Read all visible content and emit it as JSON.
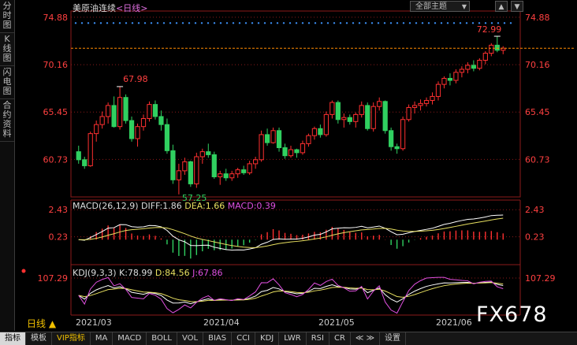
{
  "sidebar": [
    {
      "label": "分时图",
      "active": false
    },
    {
      "label": "K线图",
      "active": true
    },
    {
      "label": "闪电图",
      "active": false
    },
    {
      "label": "合约资料",
      "active": false
    }
  ],
  "header": {
    "symbol": "美原油连续",
    "period": "<日线>",
    "theme_label": "全部主题",
    "up_icon": "triangle-up-icon",
    "down_icon": "triangle-down-icon"
  },
  "chart_data": {
    "type": "candlestick",
    "price_axis": {
      "ticks": [
        "74.88",
        "70.16",
        "65.45",
        "60.73"
      ],
      "range": [
        57.0,
        75.5
      ]
    },
    "annotations": {
      "high": "67.98",
      "low": "57.25",
      "last_high": "72.99"
    },
    "dates": [
      "2021/03",
      "2021/04",
      "2021/05",
      "2021/06"
    ],
    "ohlc": [
      [
        61.5,
        62.1,
        60.3,
        60.7
      ],
      [
        60.7,
        61.0,
        59.8,
        60.1
      ],
      [
        60.1,
        63.5,
        60.0,
        63.3
      ],
      [
        63.3,
        64.6,
        62.5,
        64.2
      ],
      [
        64.2,
        65.5,
        63.8,
        65.0
      ],
      [
        65.0,
        66.4,
        64.3,
        66.1
      ],
      [
        66.1,
        67.0,
        63.9,
        64.0
      ],
      [
        64.0,
        67.98,
        63.7,
        66.9
      ],
      [
        66.9,
        67.2,
        64.3,
        64.6
      ],
      [
        64.6,
        65.0,
        62.5,
        62.8
      ],
      [
        62.8,
        64.3,
        62.0,
        64.0
      ],
      [
        64.0,
        65.2,
        63.6,
        64.8
      ],
      [
        64.8,
        66.5,
        64.5,
        66.2
      ],
      [
        66.2,
        66.6,
        64.7,
        65.0
      ],
      [
        65.0,
        65.6,
        63.6,
        64.2
      ],
      [
        64.2,
        64.8,
        61.3,
        61.6
      ],
      [
        61.6,
        62.2,
        58.3,
        58.7
      ],
      [
        58.7,
        60.3,
        57.25,
        59.6
      ],
      [
        59.6,
        60.9,
        59.2,
        60.5
      ],
      [
        60.5,
        60.6,
        58.0,
        58.3
      ],
      [
        58.3,
        61.4,
        57.9,
        61.0
      ],
      [
        61.0,
        61.8,
        60.3,
        61.5
      ],
      [
        61.5,
        62.3,
        60.9,
        61.2
      ],
      [
        61.2,
        61.5,
        58.8,
        59.0
      ],
      [
        59.0,
        59.6,
        58.2,
        59.3
      ],
      [
        59.3,
        59.8,
        58.6,
        58.9
      ],
      [
        58.9,
        59.6,
        58.6,
        59.3
      ],
      [
        59.3,
        59.9,
        58.9,
        59.7
      ],
      [
        59.7,
        60.1,
        59.2,
        59.4
      ],
      [
        59.4,
        60.6,
        59.2,
        60.3
      ],
      [
        60.3,
        61.0,
        59.8,
        60.7
      ],
      [
        60.7,
        63.6,
        60.5,
        63.2
      ],
      [
        63.2,
        63.8,
        62.1,
        62.4
      ],
      [
        62.4,
        63.9,
        62.3,
        63.6
      ],
      [
        63.6,
        63.9,
        61.5,
        61.9
      ],
      [
        61.9,
        62.3,
        60.8,
        61.1
      ],
      [
        61.1,
        62.1,
        60.9,
        61.7
      ],
      [
        61.7,
        61.8,
        60.9,
        61.4
      ],
      [
        61.4,
        62.6,
        61.2,
        62.3
      ],
      [
        62.3,
        63.3,
        62.0,
        63.1
      ],
      [
        63.1,
        64.0,
        62.7,
        63.8
      ],
      [
        63.8,
        64.2,
        62.9,
        63.2
      ],
      [
        63.2,
        65.5,
        63.0,
        65.2
      ],
      [
        65.2,
        66.6,
        64.8,
        66.4
      ],
      [
        66.4,
        66.6,
        64.3,
        64.7
      ],
      [
        64.7,
        65.3,
        63.9,
        64.9
      ],
      [
        64.9,
        65.2,
        64.2,
        64.5
      ],
      [
        64.5,
        65.4,
        63.9,
        65.2
      ],
      [
        65.2,
        66.5,
        64.9,
        66.1
      ],
      [
        66.1,
        66.4,
        63.6,
        63.8
      ],
      [
        63.8,
        66.4,
        63.5,
        66.0
      ],
      [
        66.0,
        66.9,
        65.6,
        66.5
      ],
      [
        66.5,
        66.6,
        63.3,
        63.6
      ],
      [
        63.6,
        63.9,
        61.6,
        62.0
      ],
      [
        62.0,
        62.3,
        61.3,
        61.8
      ],
      [
        61.8,
        65.0,
        61.6,
        64.7
      ],
      [
        64.7,
        66.2,
        64.5,
        65.9
      ],
      [
        65.9,
        66.5,
        65.3,
        66.1
      ],
      [
        66.1,
        66.7,
        65.6,
        66.3
      ],
      [
        66.3,
        66.9,
        66.0,
        66.6
      ],
      [
        66.6,
        67.4,
        66.2,
        67.0
      ],
      [
        67.0,
        68.5,
        66.6,
        68.2
      ],
      [
        68.2,
        69.0,
        67.8,
        68.8
      ],
      [
        68.8,
        69.3,
        68.1,
        68.6
      ],
      [
        68.6,
        69.7,
        68.3,
        69.4
      ],
      [
        69.4,
        70.0,
        68.9,
        69.7
      ],
      [
        69.7,
        70.4,
        69.3,
        70.1
      ],
      [
        70.1,
        70.6,
        69.5,
        69.8
      ],
      [
        69.8,
        70.8,
        69.6,
        70.6
      ],
      [
        70.6,
        71.5,
        70.2,
        71.3
      ],
      [
        71.3,
        72.3,
        71.0,
        72.1
      ],
      [
        72.1,
        72.99,
        71.4,
        71.6
      ],
      [
        71.6,
        72.0,
        71.2,
        71.8
      ]
    ],
    "macd": {
      "label": "MACD(26,12,9)",
      "diff": "DIFF:1.86",
      "dea": "DEA:1.66",
      "macd": "MACD:0.39",
      "ticks": [
        "2.43",
        "0.23"
      ],
      "range": [
        -1.9,
        2.7
      ]
    },
    "kdj": {
      "label": "KDJ(9,3,3)",
      "k": "K:78.99",
      "d": "D:84.56",
      "j": "J:67.86",
      "tick": "107.29"
    }
  },
  "footer": {
    "period_tag": "日线 ▲",
    "tabs": [
      {
        "label": "指标",
        "active": true
      },
      {
        "label": "模板",
        "active": false
      },
      {
        "label": "VIP指标",
        "vip": true
      },
      {
        "label": "MA"
      },
      {
        "label": "MACD"
      },
      {
        "label": "BOLL"
      },
      {
        "label": "VOL"
      },
      {
        "label": "BIAS"
      },
      {
        "label": "CCI"
      },
      {
        "label": "KDJ"
      },
      {
        "label": "LWR"
      },
      {
        "label": "RSI"
      },
      {
        "label": "CR"
      },
      {
        "label": "≪ ≫"
      },
      {
        "label": "设置"
      }
    ]
  },
  "watermark": "FX678",
  "colors": {
    "up": "#ff3030",
    "down": "#30d060",
    "diff": "#ffffff",
    "dea": "#e8e060",
    "jline": "#e050e0",
    "grid": "#8b1a1a"
  }
}
